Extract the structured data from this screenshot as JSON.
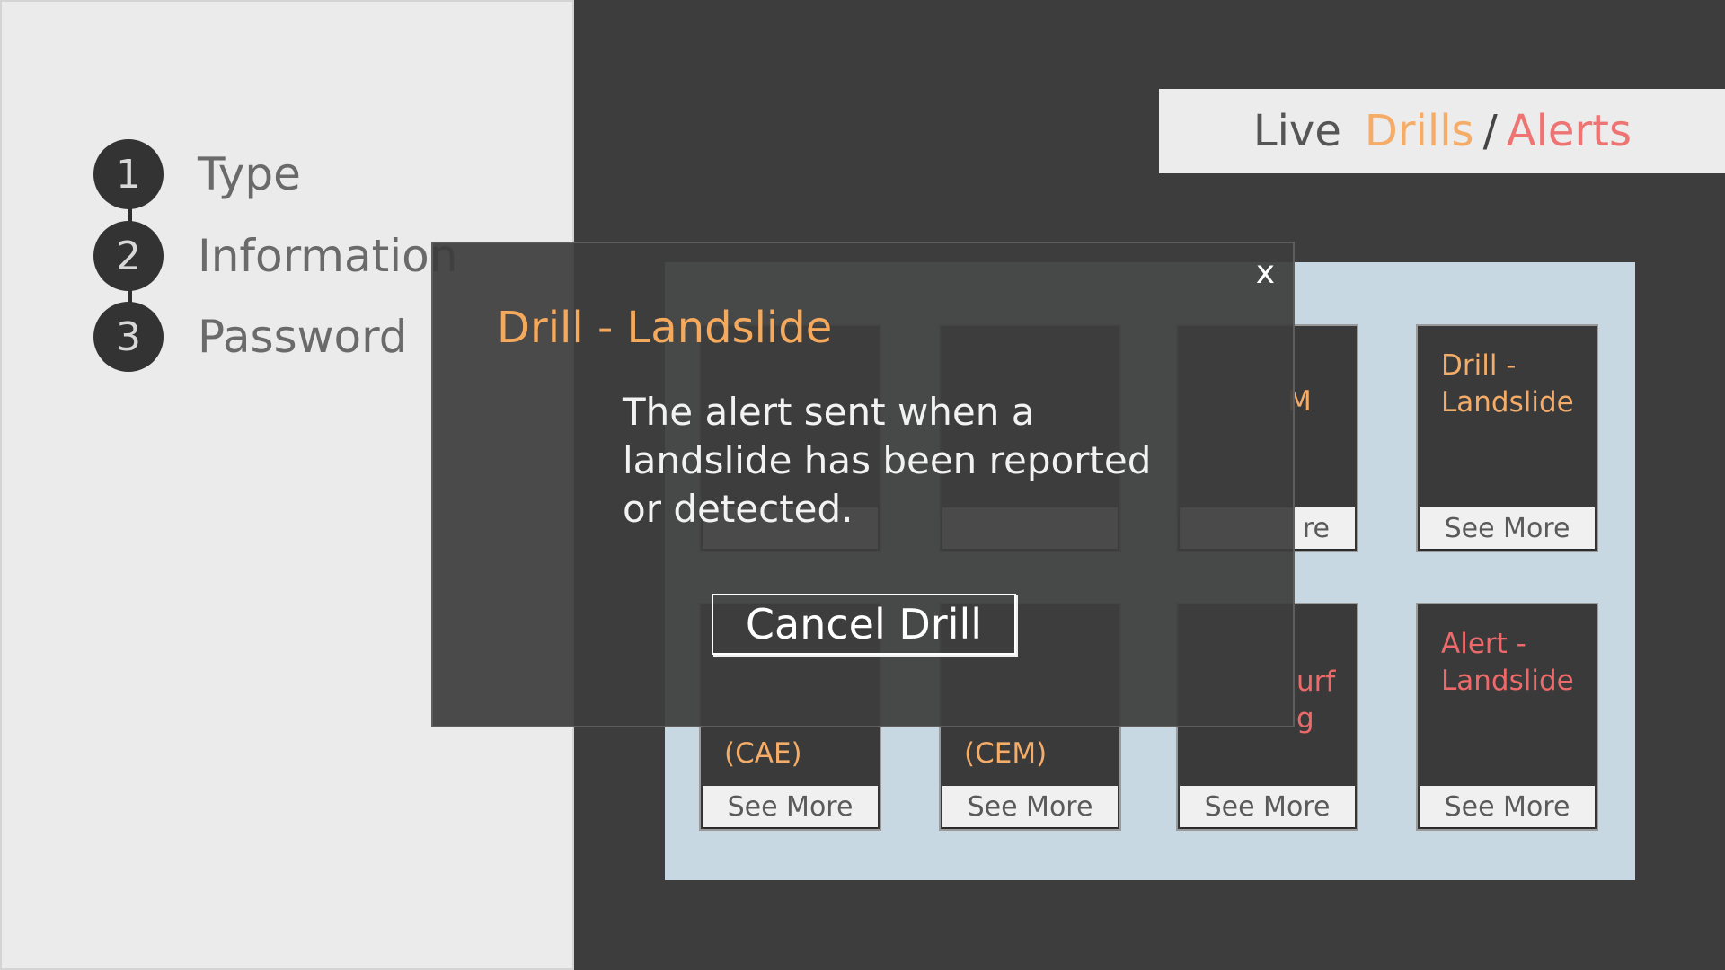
{
  "steps": [
    {
      "number": "1",
      "label": "Type"
    },
    {
      "number": "2",
      "label": "Information"
    },
    {
      "number": "3",
      "label": "Password"
    }
  ],
  "header": {
    "live": "Live",
    "drills": "Drills",
    "separator": "/",
    "alerts": "Alerts"
  },
  "tiles": [
    {
      "title": "",
      "button": "",
      "kind": "drill"
    },
    {
      "title": "",
      "button": "",
      "kind": "drill"
    },
    {
      "title": "M",
      "button": "re",
      "kind": "drill"
    },
    {
      "title": "Drill -\nLandslide",
      "button": "See More",
      "kind": "drill"
    },
    {
      "title": "(CAE)",
      "button": "See More",
      "kind": "drill"
    },
    {
      "title": "(CEM)",
      "button": "See More",
      "kind": "drill"
    },
    {
      "title": "urf\ng",
      "button": "See More",
      "kind": "alert"
    },
    {
      "title": "Alert -\nLandslide",
      "button": "See More",
      "kind": "alert"
    }
  ],
  "modal": {
    "close": "x",
    "title": "Drill - Landslide",
    "description": "The alert sent when a landslide has been reported or detected.",
    "cancel_button": "Cancel Drill"
  },
  "colors": {
    "drill_accent": "#f4a95d",
    "alert_accent": "#ee6a6a",
    "background_dark": "#3d3d3d",
    "panel_light": "#ebebeb",
    "grid_background": "#c7d8e3"
  }
}
